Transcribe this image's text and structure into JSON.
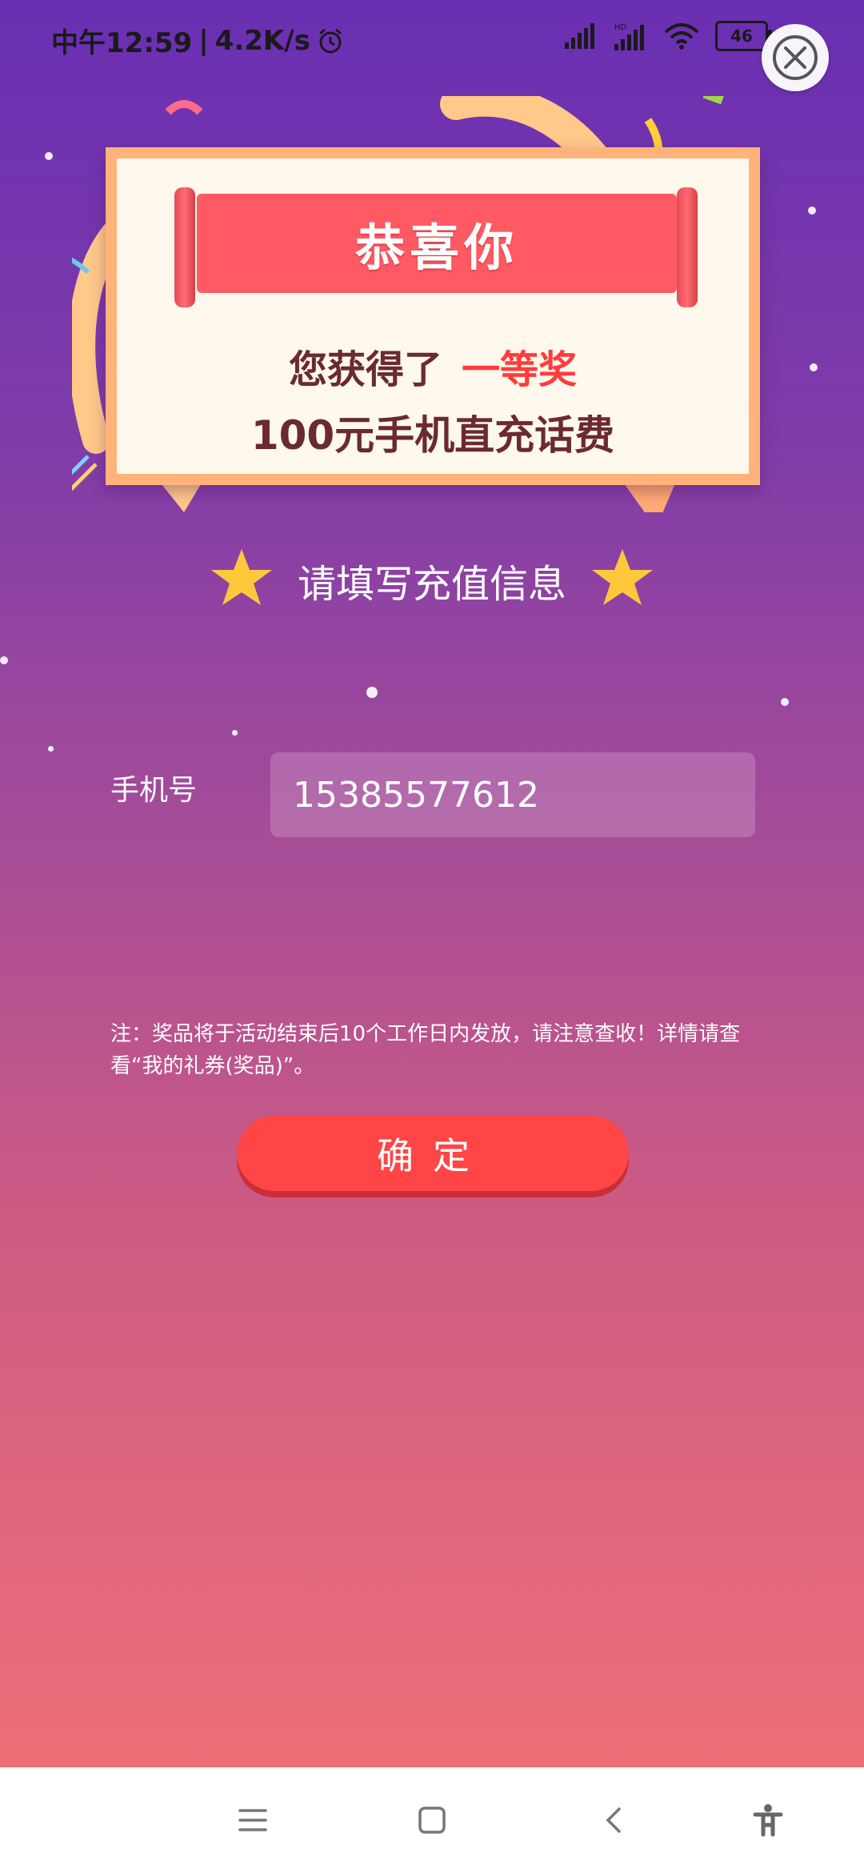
{
  "status_bar": {
    "time": "中午12:59",
    "separator": "|",
    "speed": "4.2K/s",
    "battery": "46"
  },
  "card": {
    "banner_title": "恭喜你",
    "won_prefix": "您获得了",
    "won_prize_level": "一等奖",
    "prize_desc": "100元手机直充话费"
  },
  "form": {
    "heading": "请填写充值信息",
    "phone_label": "手机号",
    "phone_value": "15385577612",
    "note": "注：奖品将于活动结束后10个工作日内发放，请注意查收！详情请查看“我的礼券(奖品)”。",
    "confirm_label": "确定"
  },
  "colors": {
    "accent_red": "#ff4546",
    "highlight_red": "#ff3b3b",
    "card_border": "#ffb27a",
    "banner": "#ff5a64"
  },
  "icons": {
    "close": "close-circle-icon",
    "menu": "menu-icon",
    "home": "home-square-icon",
    "back": "back-chevron-icon",
    "accessibility": "accessibility-icon"
  }
}
